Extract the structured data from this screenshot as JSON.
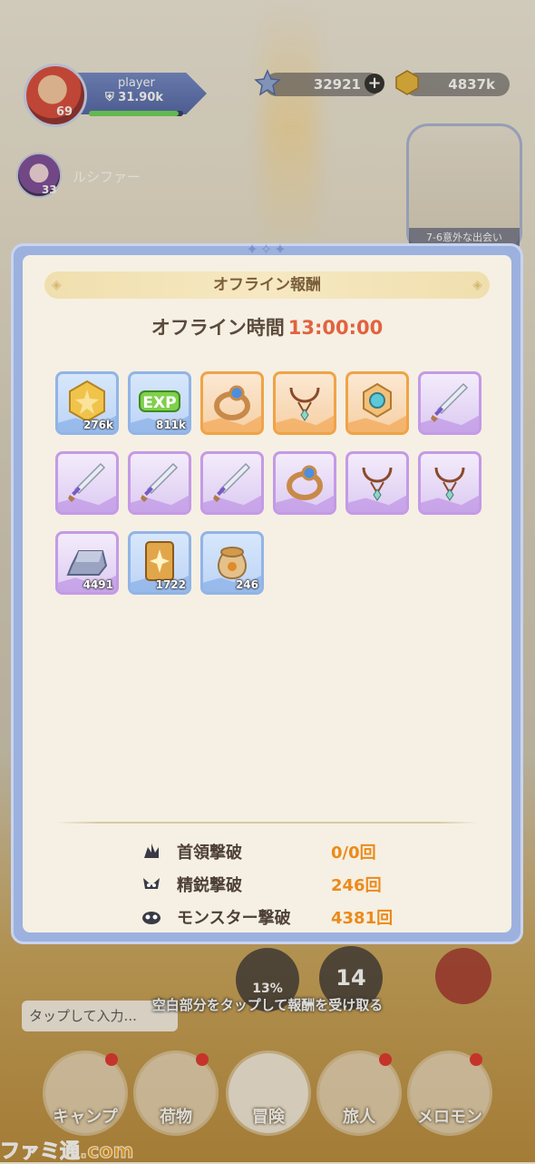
{
  "hud": {
    "player_name": "player",
    "player_power": "31.90k",
    "player_level": "69",
    "exp_fraction": 0.95,
    "gems": "32921",
    "gold": "4837k",
    "plus": "+",
    "companion_name": "ルシファー",
    "companion_level": "33",
    "quest_label": "7-6意外な出会い"
  },
  "dialog": {
    "title": "オフライン報酬",
    "offline_label": "オフライン時間",
    "offline_time": "13:00:00",
    "rewards": [
      {
        "icon": "gold-coin-icon",
        "rarity": "blue",
        "qty": "276k"
      },
      {
        "icon": "exp-icon",
        "rarity": "blue",
        "qty": "811k"
      },
      {
        "icon": "ring-icon",
        "rarity": "orange",
        "qty": ""
      },
      {
        "icon": "necklace-icon",
        "rarity": "orange",
        "qty": ""
      },
      {
        "icon": "amulet-icon",
        "rarity": "orange",
        "qty": ""
      },
      {
        "icon": "sword-icon",
        "rarity": "purple",
        "qty": ""
      },
      {
        "icon": "sword-icon",
        "rarity": "purple",
        "qty": ""
      },
      {
        "icon": "sword-icon",
        "rarity": "purple",
        "qty": ""
      },
      {
        "icon": "sword-icon",
        "rarity": "purple",
        "qty": ""
      },
      {
        "icon": "ring-icon",
        "rarity": "purple",
        "qty": ""
      },
      {
        "icon": "necklace-icon",
        "rarity": "purple",
        "qty": ""
      },
      {
        "icon": "necklace-icon",
        "rarity": "purple",
        "qty": ""
      },
      {
        "icon": "ingot-icon",
        "rarity": "purple",
        "qty": "4491"
      },
      {
        "icon": "card-icon",
        "rarity": "blue",
        "qty": "1722"
      },
      {
        "icon": "pouch-icon",
        "rarity": "blue",
        "qty": "246"
      }
    ],
    "stats": [
      {
        "icon": "boss-icon",
        "label": "首領撃破",
        "value": "0/0回"
      },
      {
        "icon": "elite-icon",
        "label": "精鋭撃破",
        "value": "246回"
      },
      {
        "icon": "monster-icon",
        "label": "モンスター撃破",
        "value": "4381回"
      }
    ]
  },
  "bottom": {
    "tap_hint": "空白部分をタップして報酬を受け取る",
    "chat_placeholder": "タップして入力...",
    "skill_percent": "13%",
    "skill_count": "14",
    "nav": [
      {
        "label": "キャンプ",
        "dot": true
      },
      {
        "label": "荷物",
        "dot": true
      },
      {
        "label": "冒険",
        "dot": false
      },
      {
        "label": "旅人",
        "dot": true
      },
      {
        "label": "メロモン",
        "dot": true
      }
    ],
    "watermark": "ファミ通.com"
  }
}
